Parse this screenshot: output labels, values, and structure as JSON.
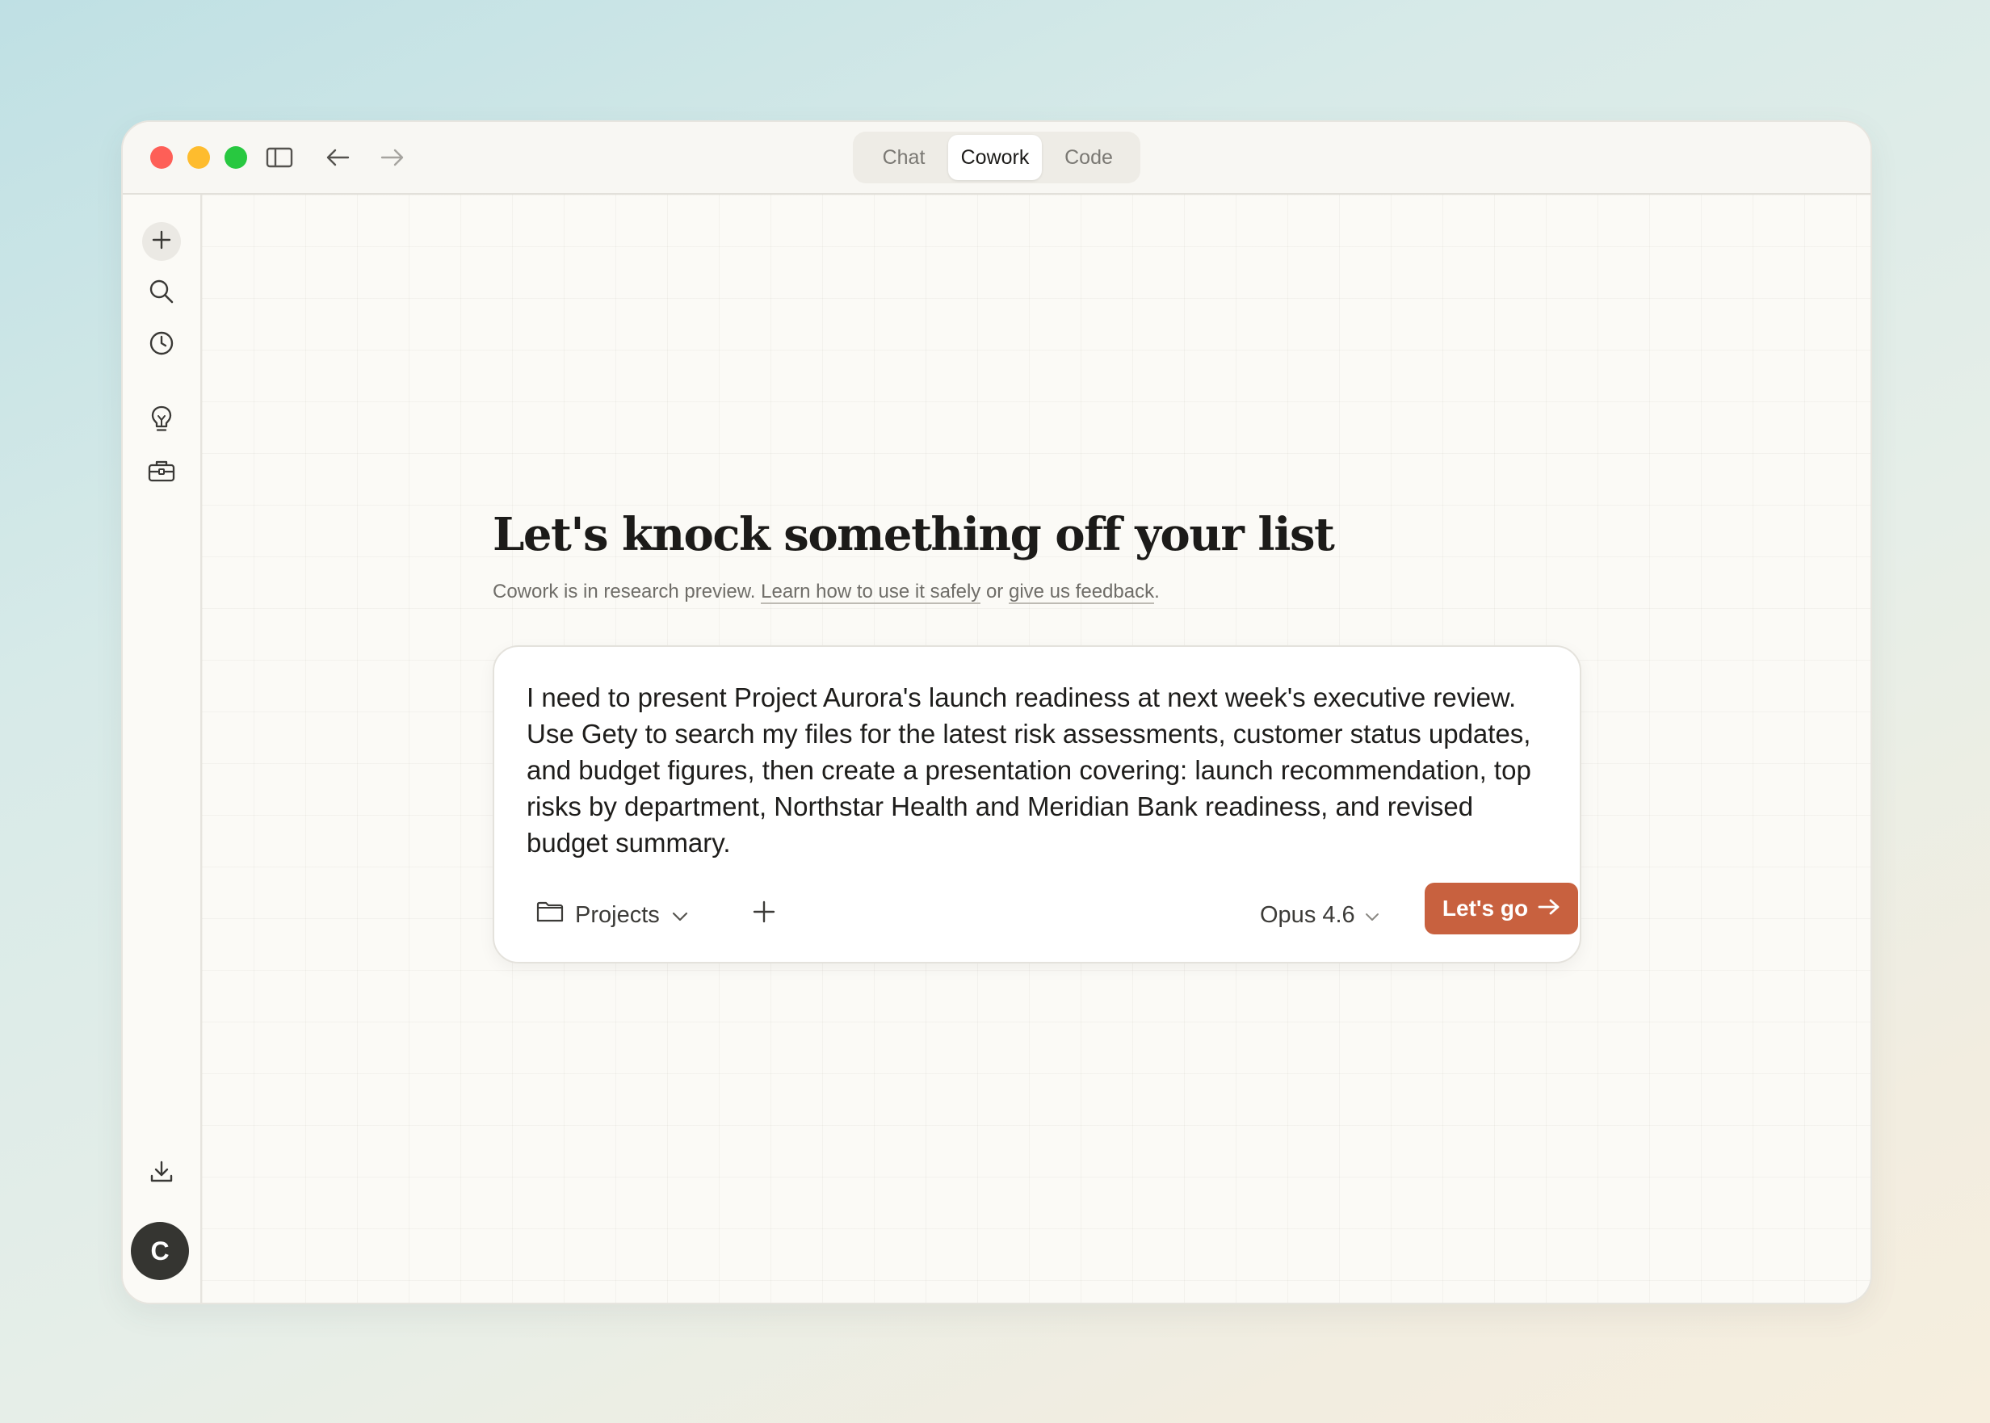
{
  "titlebar": {
    "tabs": [
      {
        "label": "Chat",
        "active": false
      },
      {
        "label": "Cowork",
        "active": true
      },
      {
        "label": "Code",
        "active": false
      }
    ],
    "icons": [
      "sidebar-toggle-icon",
      "back-arrow-icon",
      "forward-arrow-icon"
    ]
  },
  "sidebar": {
    "icons": [
      "plus-icon",
      "search-icon",
      "clock-icon",
      "lightbulb-icon",
      "toolbox-icon",
      "download-icon"
    ],
    "avatar_initial": "C"
  },
  "main": {
    "headline": "Let's knock something off your list",
    "subtitle": {
      "prefix": "Cowork is in research preview. ",
      "link1": "Learn how to use it safely",
      "middle": " or ",
      "link2": "give us feedback",
      "suffix": "."
    }
  },
  "composer": {
    "prompt": "I need to present Project Aurora's launch readiness at next week's executive review. Use Gety to search my files for the latest risk assessments, customer status updates, and budget figures, then create a presentation covering: launch recommendation, top risks by department, Northstar Health and Meridian Bank readiness, and revised budget summary.",
    "projects_label": "Projects",
    "model_label": "Opus 4.6",
    "submit_label": "Let's go"
  },
  "colors": {
    "accent": "#c8613f",
    "traffic_red": "#fe5f57",
    "traffic_yellow": "#febc2e",
    "traffic_green": "#28c840",
    "avatar": "#353531"
  }
}
